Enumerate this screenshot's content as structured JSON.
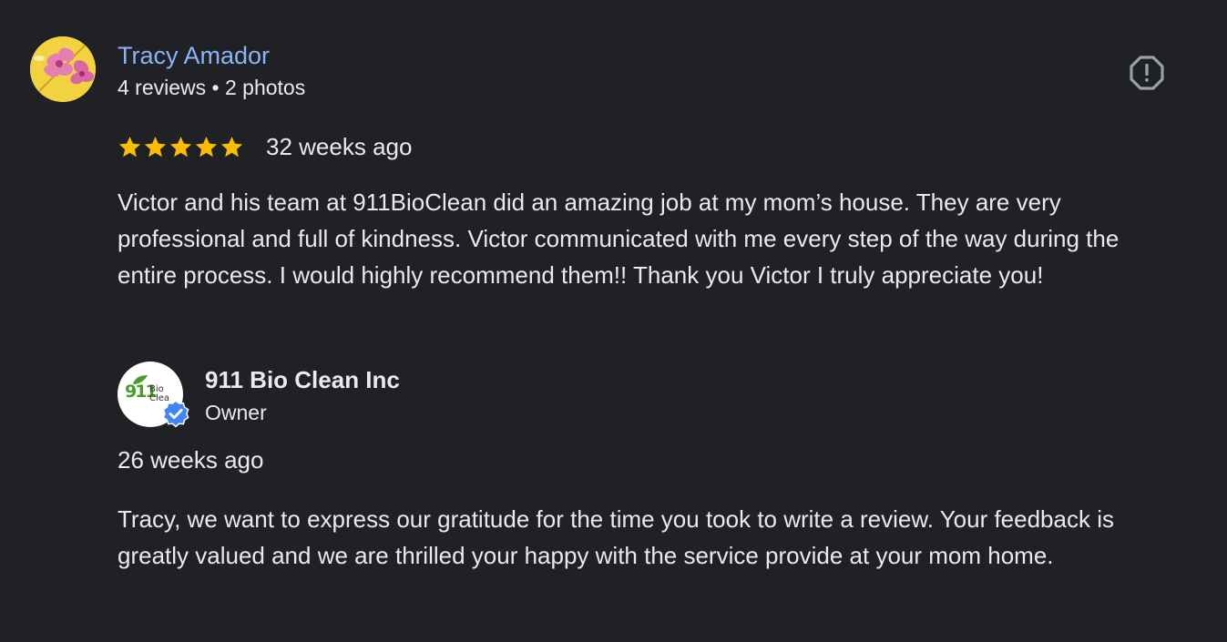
{
  "review": {
    "reviewer_name": "Tracy Amador",
    "reviewer_meta": "4 reviews • 2 photos",
    "rating": 5,
    "rating_max": 5,
    "date": "32 weeks ago",
    "text": "Victor and his team at 911BioClean did an amazing job at my mom’s house. They are very professional and full of kindness. Victor communicated with me every step of the way during the entire process. I would highly recommend them!! Thank you Victor I truly appreciate you!",
    "report_icon": "report-icon"
  },
  "owner_reply": {
    "name": "911 Bio Clean Inc",
    "role": "Owner",
    "logo_text": "911",
    "logo_sub": "Bio Clea",
    "verified_icon": "verified-check-icon",
    "date": "26 weeks ago",
    "text": "Tracy, we want to express our gratitude for the time you took to write a review. Your feedback is greatly valued and we are thrilled your happy with the service provide at your mom home."
  },
  "colors": {
    "background": "#202124",
    "text": "#e8eaed",
    "link": "#8ab4f8",
    "star": "#fbbc04",
    "verified": "#4285f4"
  }
}
